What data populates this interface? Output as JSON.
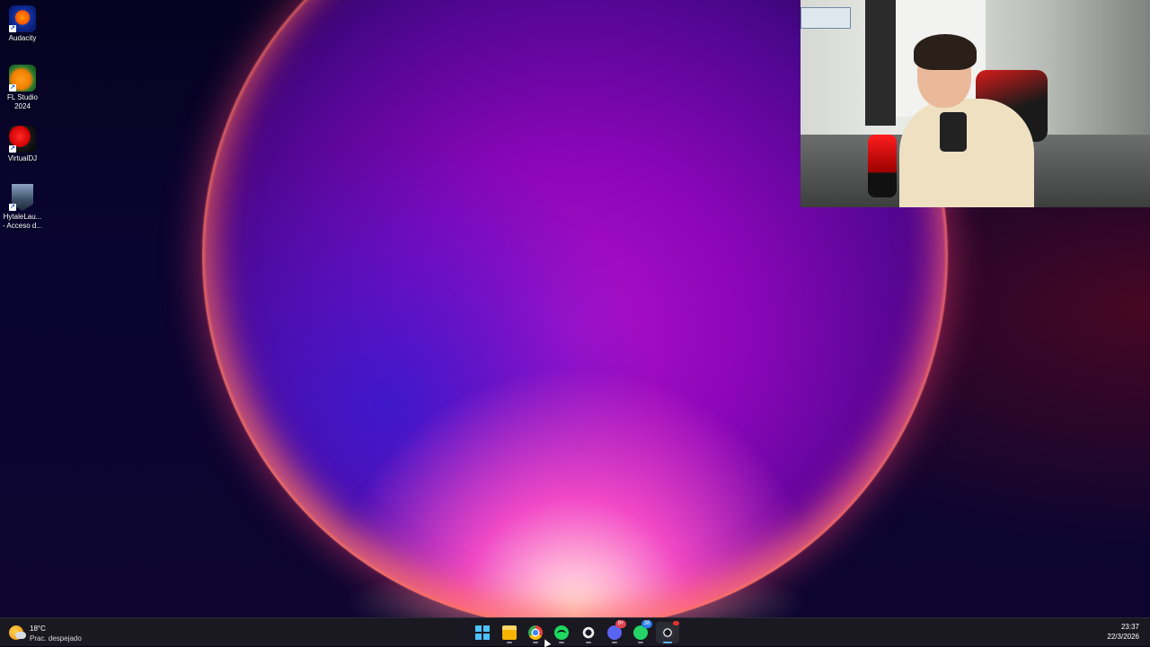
{
  "desktop": {
    "icons": [
      {
        "label": "Audacity",
        "icon": "audacity-icon"
      },
      {
        "label": "FL Studio 2024",
        "icon": "fl-studio-icon"
      },
      {
        "label": "VirtualDJ",
        "icon": "virtualdj-icon"
      },
      {
        "label": "HytaleLau... - Acceso d...",
        "icon": "hytale-launcher-icon"
      }
    ],
    "shortcut_glyph": "↗"
  },
  "webcam": {
    "label": "webcam-overlay"
  },
  "taskbar": {
    "weather": {
      "temp": "18°C",
      "desc": "Prac. despejado",
      "icon": "weather-sun-cloud-icon"
    },
    "apps": [
      {
        "name": "start",
        "icon": "windows-start-icon"
      },
      {
        "name": "file-explorer",
        "icon": "folder-icon"
      },
      {
        "name": "chrome",
        "icon": "chrome-icon"
      },
      {
        "name": "spotify",
        "icon": "spotify-icon"
      },
      {
        "name": "steam",
        "icon": "steam-icon"
      },
      {
        "name": "discord",
        "icon": "discord-icon",
        "badge": "9+",
        "badge_color": "#e04250"
      },
      {
        "name": "whatsapp",
        "icon": "whatsapp-icon",
        "badge": "38",
        "badge_color": "#2b7de9"
      },
      {
        "name": "obs",
        "icon": "obs-icon",
        "badge": "",
        "badge_color": "#e0322e"
      }
    ],
    "clock": {
      "time": "23:37",
      "date": "22/3/2026"
    }
  },
  "colors": {
    "accent": "#4cc2ff",
    "taskbar_bg": "#1a1922"
  }
}
